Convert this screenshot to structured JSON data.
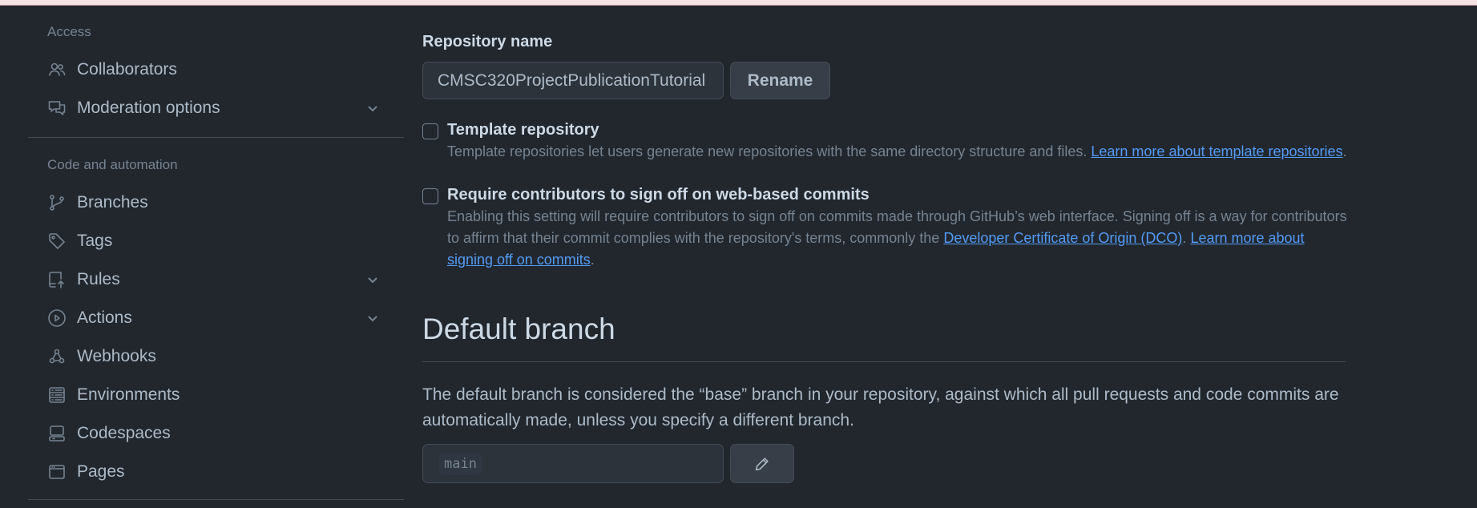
{
  "sidebar": {
    "access_heading": "Access",
    "access_items": [
      {
        "label": "Collaborators",
        "icon": "people-icon"
      },
      {
        "label": "Moderation options",
        "icon": "comment-discussion-icon",
        "expandable": true
      }
    ],
    "code_heading": "Code and automation",
    "code_items": [
      {
        "label": "Branches",
        "icon": "git-branch-icon"
      },
      {
        "label": "Tags",
        "icon": "tag-icon"
      },
      {
        "label": "Rules",
        "icon": "repo-push-icon",
        "expandable": true
      },
      {
        "label": "Actions",
        "icon": "play-icon",
        "expandable": true
      },
      {
        "label": "Webhooks",
        "icon": "webhook-icon"
      },
      {
        "label": "Environments",
        "icon": "server-icon"
      },
      {
        "label": "Codespaces",
        "icon": "codespaces-icon"
      },
      {
        "label": "Pages",
        "icon": "browser-icon"
      }
    ]
  },
  "main": {
    "repo_name_label": "Repository name",
    "repo_name_value": "CMSC320ProjectPublicationTutorial",
    "rename_button": "Rename",
    "template": {
      "label": "Template repository",
      "checked": false,
      "help": "Template repositories let users generate new repositories with the same directory structure and files.",
      "link": "Learn more about template repositories",
      "tail": "."
    },
    "signoff": {
      "label": "Require contributors to sign off on web-based commits",
      "checked": false,
      "help": "Enabling this setting will require contributors to sign off on commits made through GitHub’s web interface. Signing off is a way for contributors to affirm that their commit complies with the repository's terms, commonly the",
      "link1": "Developer Certificate of Origin (DCO)",
      "mid": ".",
      "link2": "Learn more about signing off on commits",
      "tail": "."
    },
    "default_branch": {
      "title": "Default branch",
      "description": "The default branch is considered the “base” branch in your repository, against which all pull requests and code commits are automatically made, unless you specify a different branch.",
      "branch": "main",
      "edit_icon": "pencil-icon"
    }
  },
  "colors": {
    "background": "#22272e",
    "link": "#539bf5",
    "border": "#444c56",
    "muted": "#768390"
  }
}
